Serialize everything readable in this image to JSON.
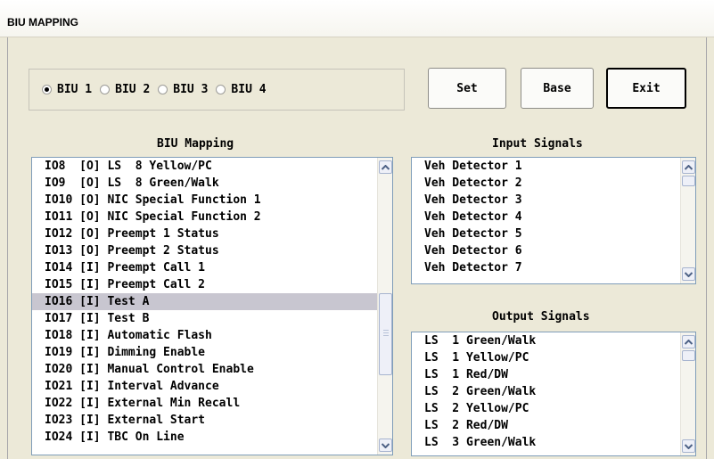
{
  "window": {
    "title": "BIU MAPPING"
  },
  "biu_selector": {
    "options": [
      "BIU  1",
      "BIU  2",
      "BIU  3",
      "BIU  4"
    ],
    "selected": "BIU  1"
  },
  "buttons": {
    "set": "Set",
    "base": "Base",
    "exit": "Exit"
  },
  "biu_mapping": {
    "title": "BIU Mapping",
    "selected_row": "IO16 [I] Test A",
    "rows": [
      "IO8  [O] LS  8 Yellow/PC",
      "IO9  [O] LS  8 Green/Walk",
      "IO10 [O] NIC Special Function 1",
      "IO11 [O] NIC Special Function 2",
      "IO12 [O] Preempt 1 Status",
      "IO13 [O] Preempt 2 Status",
      "IO14 [I] Preempt Call 1",
      "IO15 [I] Preempt Call 2",
      "IO16 [I] Test A",
      "IO17 [I] Test B",
      "IO18 [I] Automatic Flash",
      "IO19 [I] Dimming Enable",
      "IO20 [I] Manual Control Enable",
      "IO21 [I] Interval Advance",
      "IO22 [I] External Min Recall",
      "IO23 [I] External Start",
      "IO24 [I] TBC On Line"
    ]
  },
  "input_signals": {
    "title": "Input Signals",
    "rows": [
      "Veh Detector 1",
      "Veh Detector 2",
      "Veh Detector 3",
      "Veh Detector 4",
      "Veh Detector 5",
      "Veh Detector 6",
      "Veh Detector 7"
    ]
  },
  "output_signals": {
    "title": "Output Signals",
    "rows": [
      "LS  1 Green/Walk",
      "LS  1 Yellow/PC",
      "LS  1 Red/DW",
      "LS  2 Green/Walk",
      "LS  2 Yellow/PC",
      "LS  2 Red/DW",
      "LS  3 Green/Walk"
    ]
  },
  "icons": {
    "scroll_up": "up-arrow-icon",
    "scroll_down": "down-arrow-icon"
  }
}
